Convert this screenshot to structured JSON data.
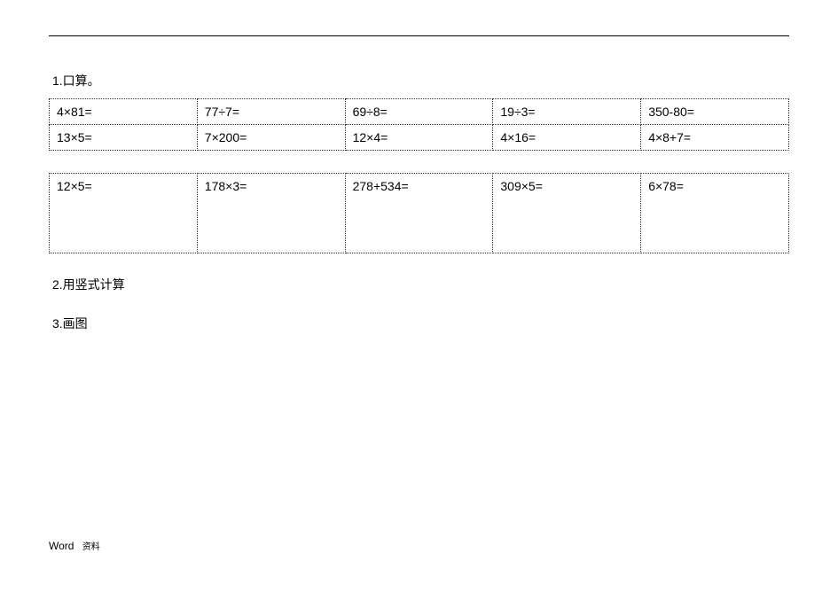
{
  "sections": {
    "s1": {
      "title": "1.口算。"
    },
    "s2": {
      "title": "2.用竖式计算"
    },
    "s3": {
      "title": "3.画图"
    }
  },
  "table1": {
    "r1": {
      "c1": "4×81=",
      "c2": "77÷7=",
      "c3": "69÷8=",
      "c4": "19÷3=",
      "c5": "350-80="
    },
    "r2": {
      "c1": "13×5=",
      "c2": "7×200=",
      "c3": "12×4=",
      "c4": "4×16=",
      "c5": "4×8+7="
    }
  },
  "table2": {
    "r1": {
      "c1": "12×5=",
      "c2": "178×3=",
      "c3": "278+534=",
      "c4": "309×5=",
      "c5": "6×78="
    }
  },
  "footer": {
    "word": "Word",
    "sub": "资料"
  }
}
